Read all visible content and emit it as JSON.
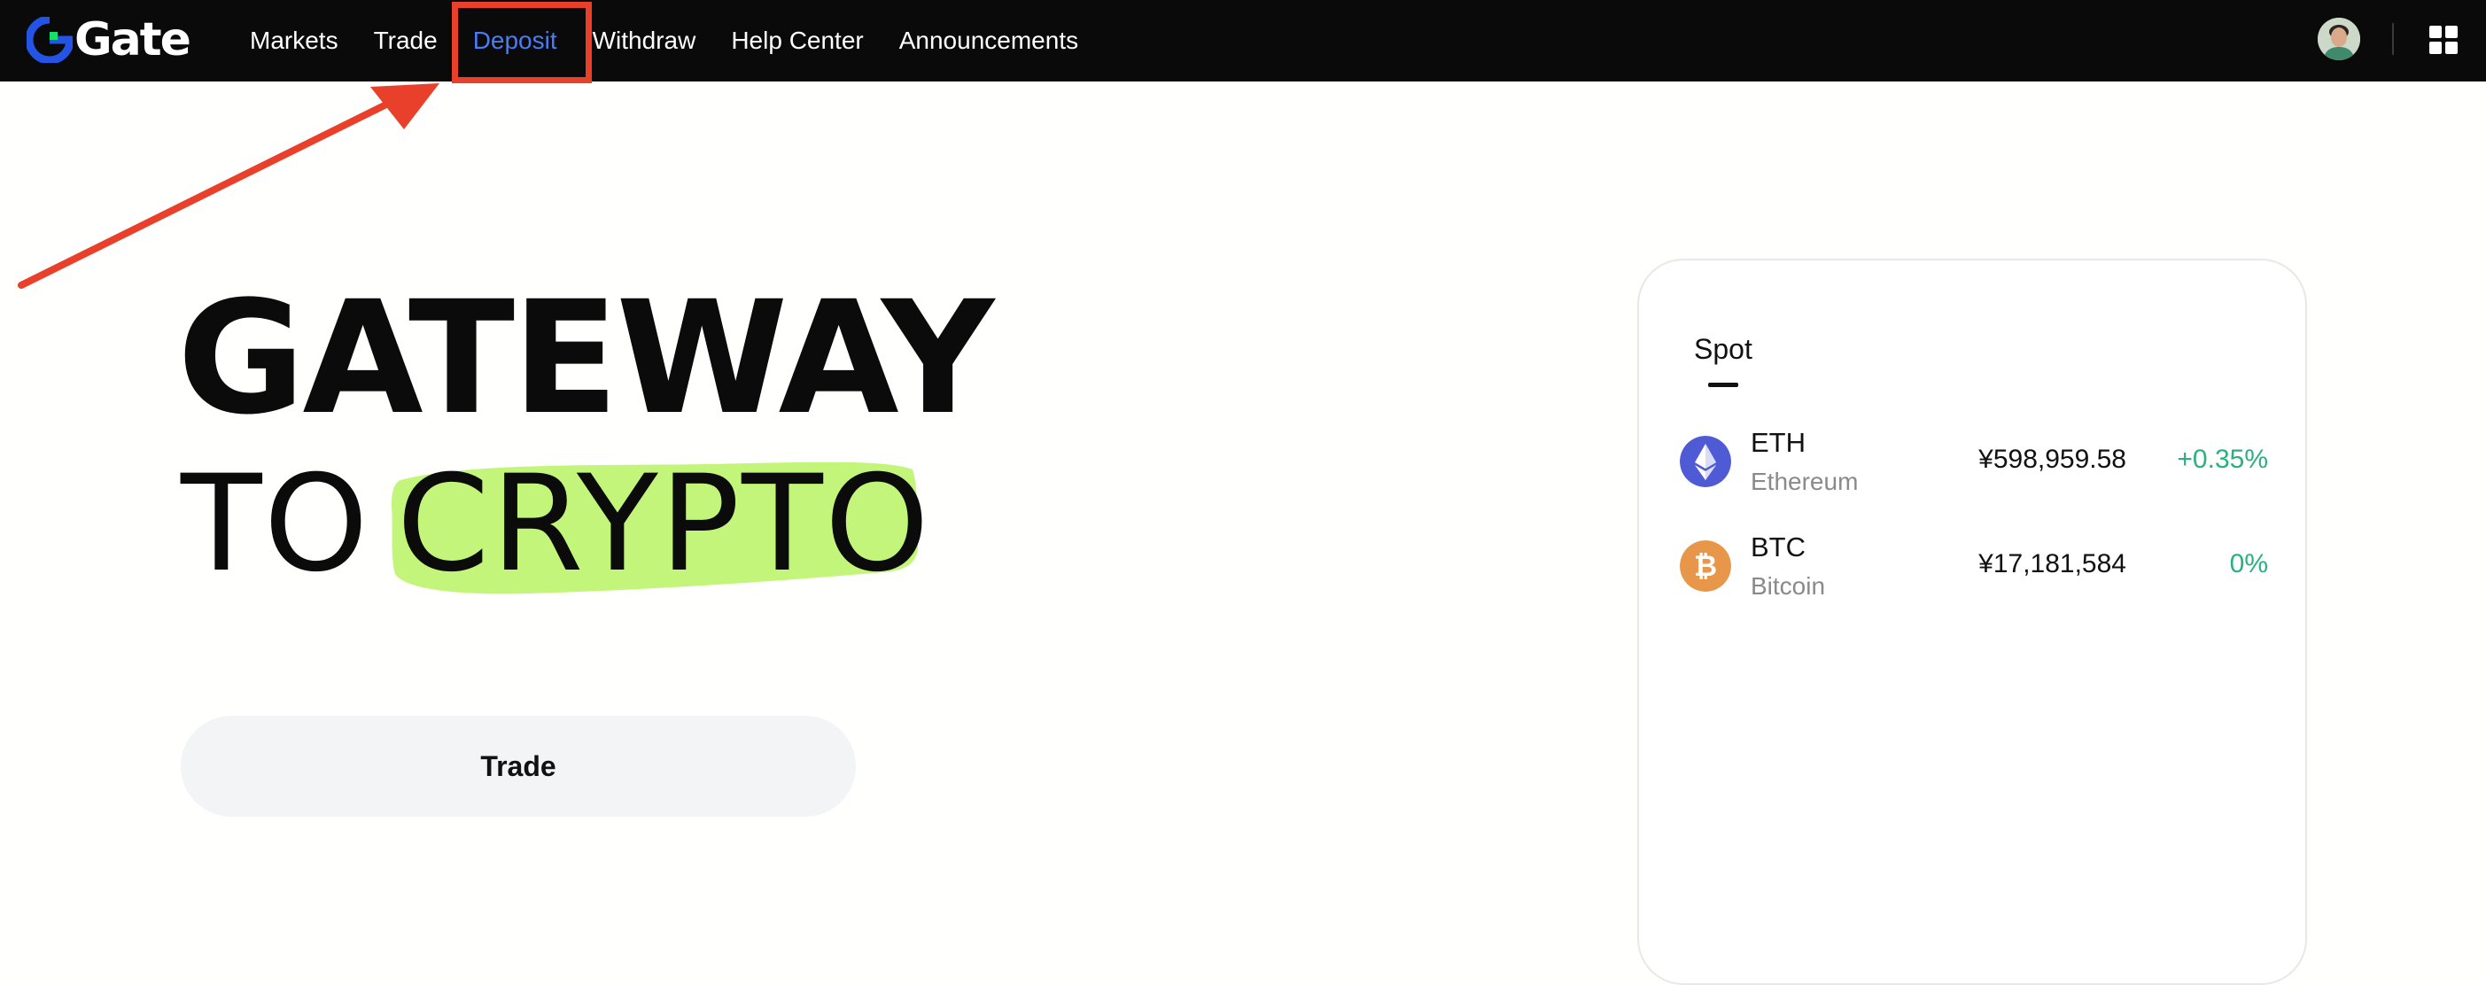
{
  "brand": {
    "logo_text": "Gate",
    "colors": {
      "nav_background": "#0a0a0a",
      "active_nav": "#4a7cf6",
      "logo_blue": "#2354e6",
      "logo_green": "#18e06b",
      "highlight_green": "#c2f57a",
      "annotation_red": "#e8402a",
      "positive_change": "#2bb07f"
    }
  },
  "nav": {
    "items": [
      {
        "label": "Markets",
        "active": false
      },
      {
        "label": "Trade",
        "active": false
      },
      {
        "label": "Deposit",
        "active": true
      },
      {
        "label": "Withdraw",
        "active": false
      },
      {
        "label": "Help Center",
        "active": false
      },
      {
        "label": "Announcements",
        "active": false
      }
    ],
    "right_icons": [
      "user-avatar",
      "apps-grid-icon"
    ]
  },
  "annotation": {
    "highlighted_item": "Deposit",
    "arrow_icon": "red-arrow-pointer"
  },
  "hero": {
    "line1": "GATEWAY",
    "line2_prefix": "TO",
    "line2_highlight": "CRYPTO",
    "cta_label": "Trade"
  },
  "markets_card": {
    "active_tab": "Spot",
    "rows": [
      {
        "symbol": "ETH",
        "name": "Ethereum",
        "price": "¥598,959.58",
        "change": "+0.35%",
        "icon": "ethereum-icon"
      },
      {
        "symbol": "BTC",
        "name": "Bitcoin",
        "price": "¥17,181,584",
        "change": "0%",
        "icon": "bitcoin-icon"
      }
    ]
  }
}
